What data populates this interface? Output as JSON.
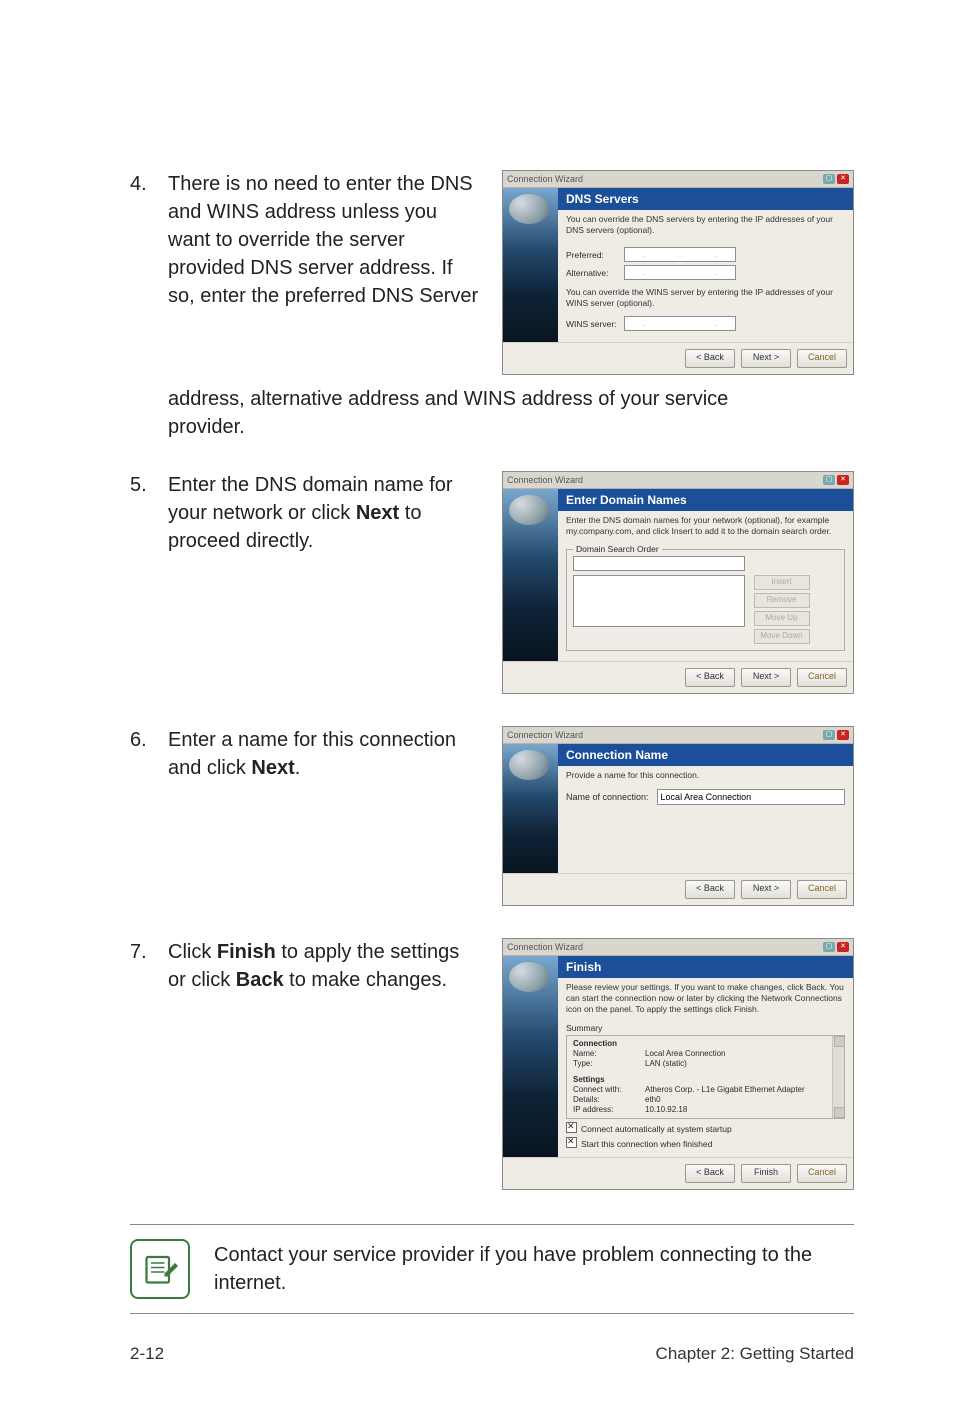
{
  "steps": {
    "s4": {
      "num": "4.",
      "text_a": "There is no need to enter the DNS and WINS address unless you want to override the server provided DNS server address. If so, enter the preferred DNS Server",
      "text_b": "address, alternative address and WINS address of your service provider."
    },
    "s5": {
      "num": "5.",
      "text": "Enter the DNS domain name for your network or click <b>Next</b> to proceed directly."
    },
    "s6": {
      "num": "6.",
      "text": "Enter a name for this connection and click <b>Next</b>."
    },
    "s7": {
      "num": "7.",
      "text": "Click <b>Finish</b> to apply the settings or click <b>Back</b> to make changes."
    }
  },
  "wizard_common": {
    "window_title": "Connection Wizard",
    "back": "< Back",
    "next": "Next >",
    "finish": "Finish",
    "cancel": "Cancel"
  },
  "wizard1": {
    "title": "DNS Servers",
    "desc1": "You can override the DNS servers by entering the IP addresses of your DNS servers (optional).",
    "preferred": "Preferred:",
    "alternative": "Alternative:",
    "desc2": "You can override the WINS server by entering the IP addresses of your WINS server (optional).",
    "wins": "WINS server:"
  },
  "wizard2": {
    "title": "Enter Domain Names",
    "desc": "Enter the DNS domain names for your network (optional), for example my.company.com, and click Insert to add it to the domain search order.",
    "legend": "Domain Search Order",
    "btn_insert": "Insert",
    "btn_remove": "Remove",
    "btn_up": "Move Up",
    "btn_down": "Move Down"
  },
  "wizard3": {
    "title": "Connection Name",
    "desc": "Provide a name for this connection.",
    "label": "Name of connection:",
    "value": "Local Area Connection"
  },
  "wizard4": {
    "title": "Finish",
    "desc": "Please review your settings. If you want to make changes, click Back. You can start the connection now or later by clicking the Network Connections icon on the panel. To apply the settings click Finish.",
    "summary_label": "Summary",
    "group1": "Connection",
    "name_k": "Name:",
    "name_v": "Local Area Connection",
    "type_k": "Type:",
    "type_v": "LAN (static)",
    "group2": "Settings",
    "cw_k": "Connect with:",
    "cw_v": "Atheros Corp. - L1e Gigabit Ethernet Adapter",
    "det_k": "Details:",
    "det_v": "eth0",
    "ip_k": "IP address:",
    "ip_v": "10.10.92.18",
    "chk1": "Connect automatically at system startup",
    "chk2": "Start this connection when finished"
  },
  "callout": "Contact your service provider if you have problem connecting to the internet.",
  "footer": {
    "left": "2-12",
    "right": "Chapter 2: Getting Started"
  }
}
